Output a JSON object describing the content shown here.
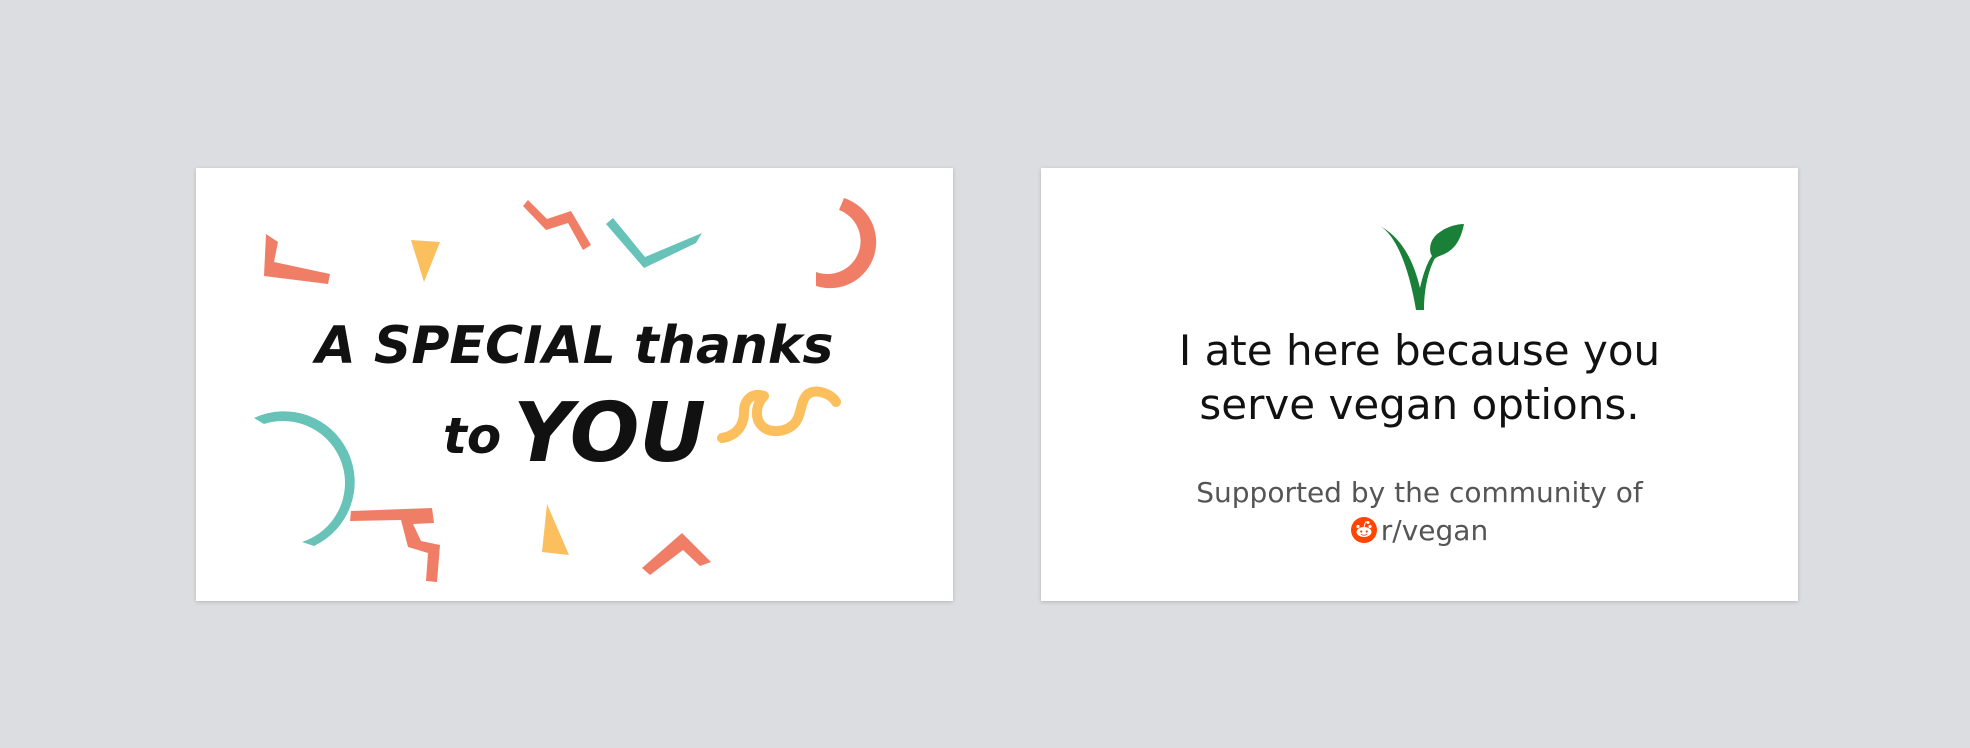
{
  "front_card": {
    "line1": "A SPECIAL thanks",
    "line2_small": "to",
    "line2_big": "YOU",
    "colors": {
      "coral": "#f07e67",
      "teal": "#67c2b8",
      "yellow": "#fbbf5d"
    }
  },
  "back_card": {
    "logo_icon": "vegan-leaf-icon",
    "logo_color": "#1a7f37",
    "message_line1": "I ate here because you",
    "message_line2": "serve vegan options.",
    "supported_text": "Supported by the community of",
    "community_icon": "reddit-icon",
    "community_icon_color": "#ff4500",
    "community_name": "r/vegan"
  }
}
